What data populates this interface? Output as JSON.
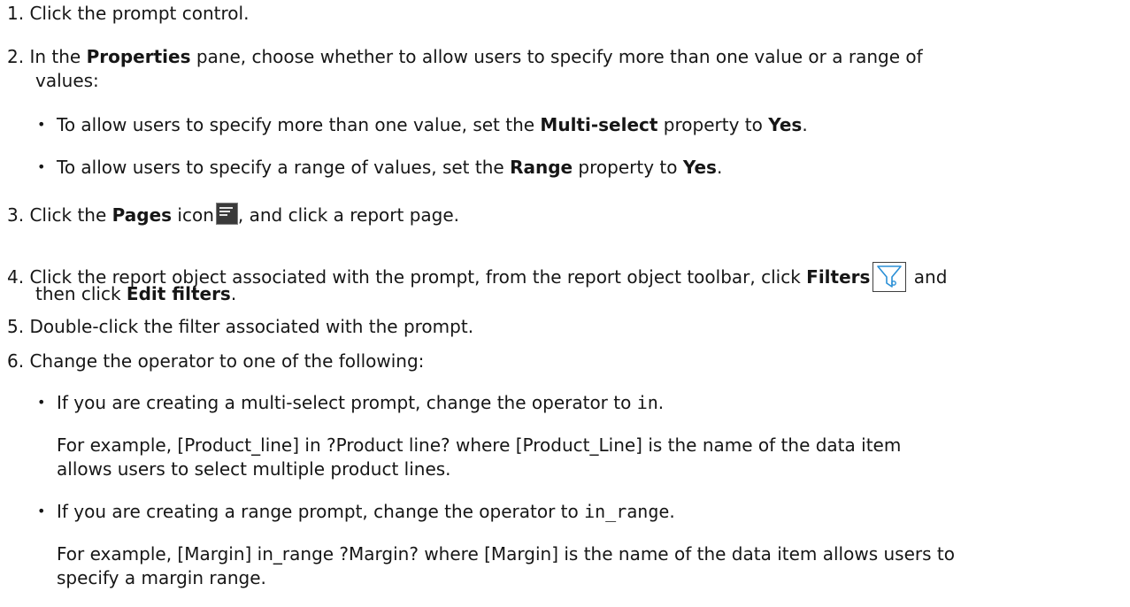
{
  "steps": {
    "s1": {
      "num": "1.",
      "text": "Click the prompt control."
    },
    "s2": {
      "num": "2.",
      "pre": "In the ",
      "bold": "Properties",
      "post": " pane, choose whether to allow users to specify more than one value or a range of",
      "cont": "values:",
      "bullets": [
        {
          "pre": "To allow users to specify more than one value, set the ",
          "b1": "Multi-select",
          "mid": " property to ",
          "b2": "Yes",
          "end": "."
        },
        {
          "pre": "To allow users to specify a range of values, set the ",
          "b1": "Range",
          "mid": " property to ",
          "b2": "Yes",
          "end": "."
        }
      ]
    },
    "s3": {
      "num": "3.",
      "pre": "Click the ",
      "bold": "Pages",
      "mid": " icon",
      "post": ", and click a report page."
    },
    "s4": {
      "num": "4.",
      "pre": "Click the report object associated with the prompt, from the report object toolbar, click ",
      "bold": "Filters",
      "post": " and",
      "cont_pre": "then click ",
      "cont_bold": "Edit filters",
      "cont_end": "."
    },
    "s5": {
      "num": "5.",
      "text": "Double-click the filter associated with the prompt."
    },
    "s6": {
      "num": "6.",
      "text": "Change the operator to one of the following:",
      "bullets": [
        {
          "pre": "If you are creating a multi-select prompt, change the operator to ",
          "code": "in",
          "end": ".",
          "example_l1": "For example, [Product_line] in ?Product line? where [Product_Line] is the name of the data item",
          "example_l2": "allows users to select multiple product lines."
        },
        {
          "pre": "If you are creating a range prompt, change the operator to ",
          "code": "in_range",
          "end": ".",
          "example_l1": "For example, [Margin] in_range ?Margin? where [Margin] is the name of the data item allows users to",
          "example_l2": "specify a margin range."
        }
      ]
    }
  },
  "icons": {
    "pages": "pages-icon",
    "filters": "filter-funnel-icon"
  }
}
